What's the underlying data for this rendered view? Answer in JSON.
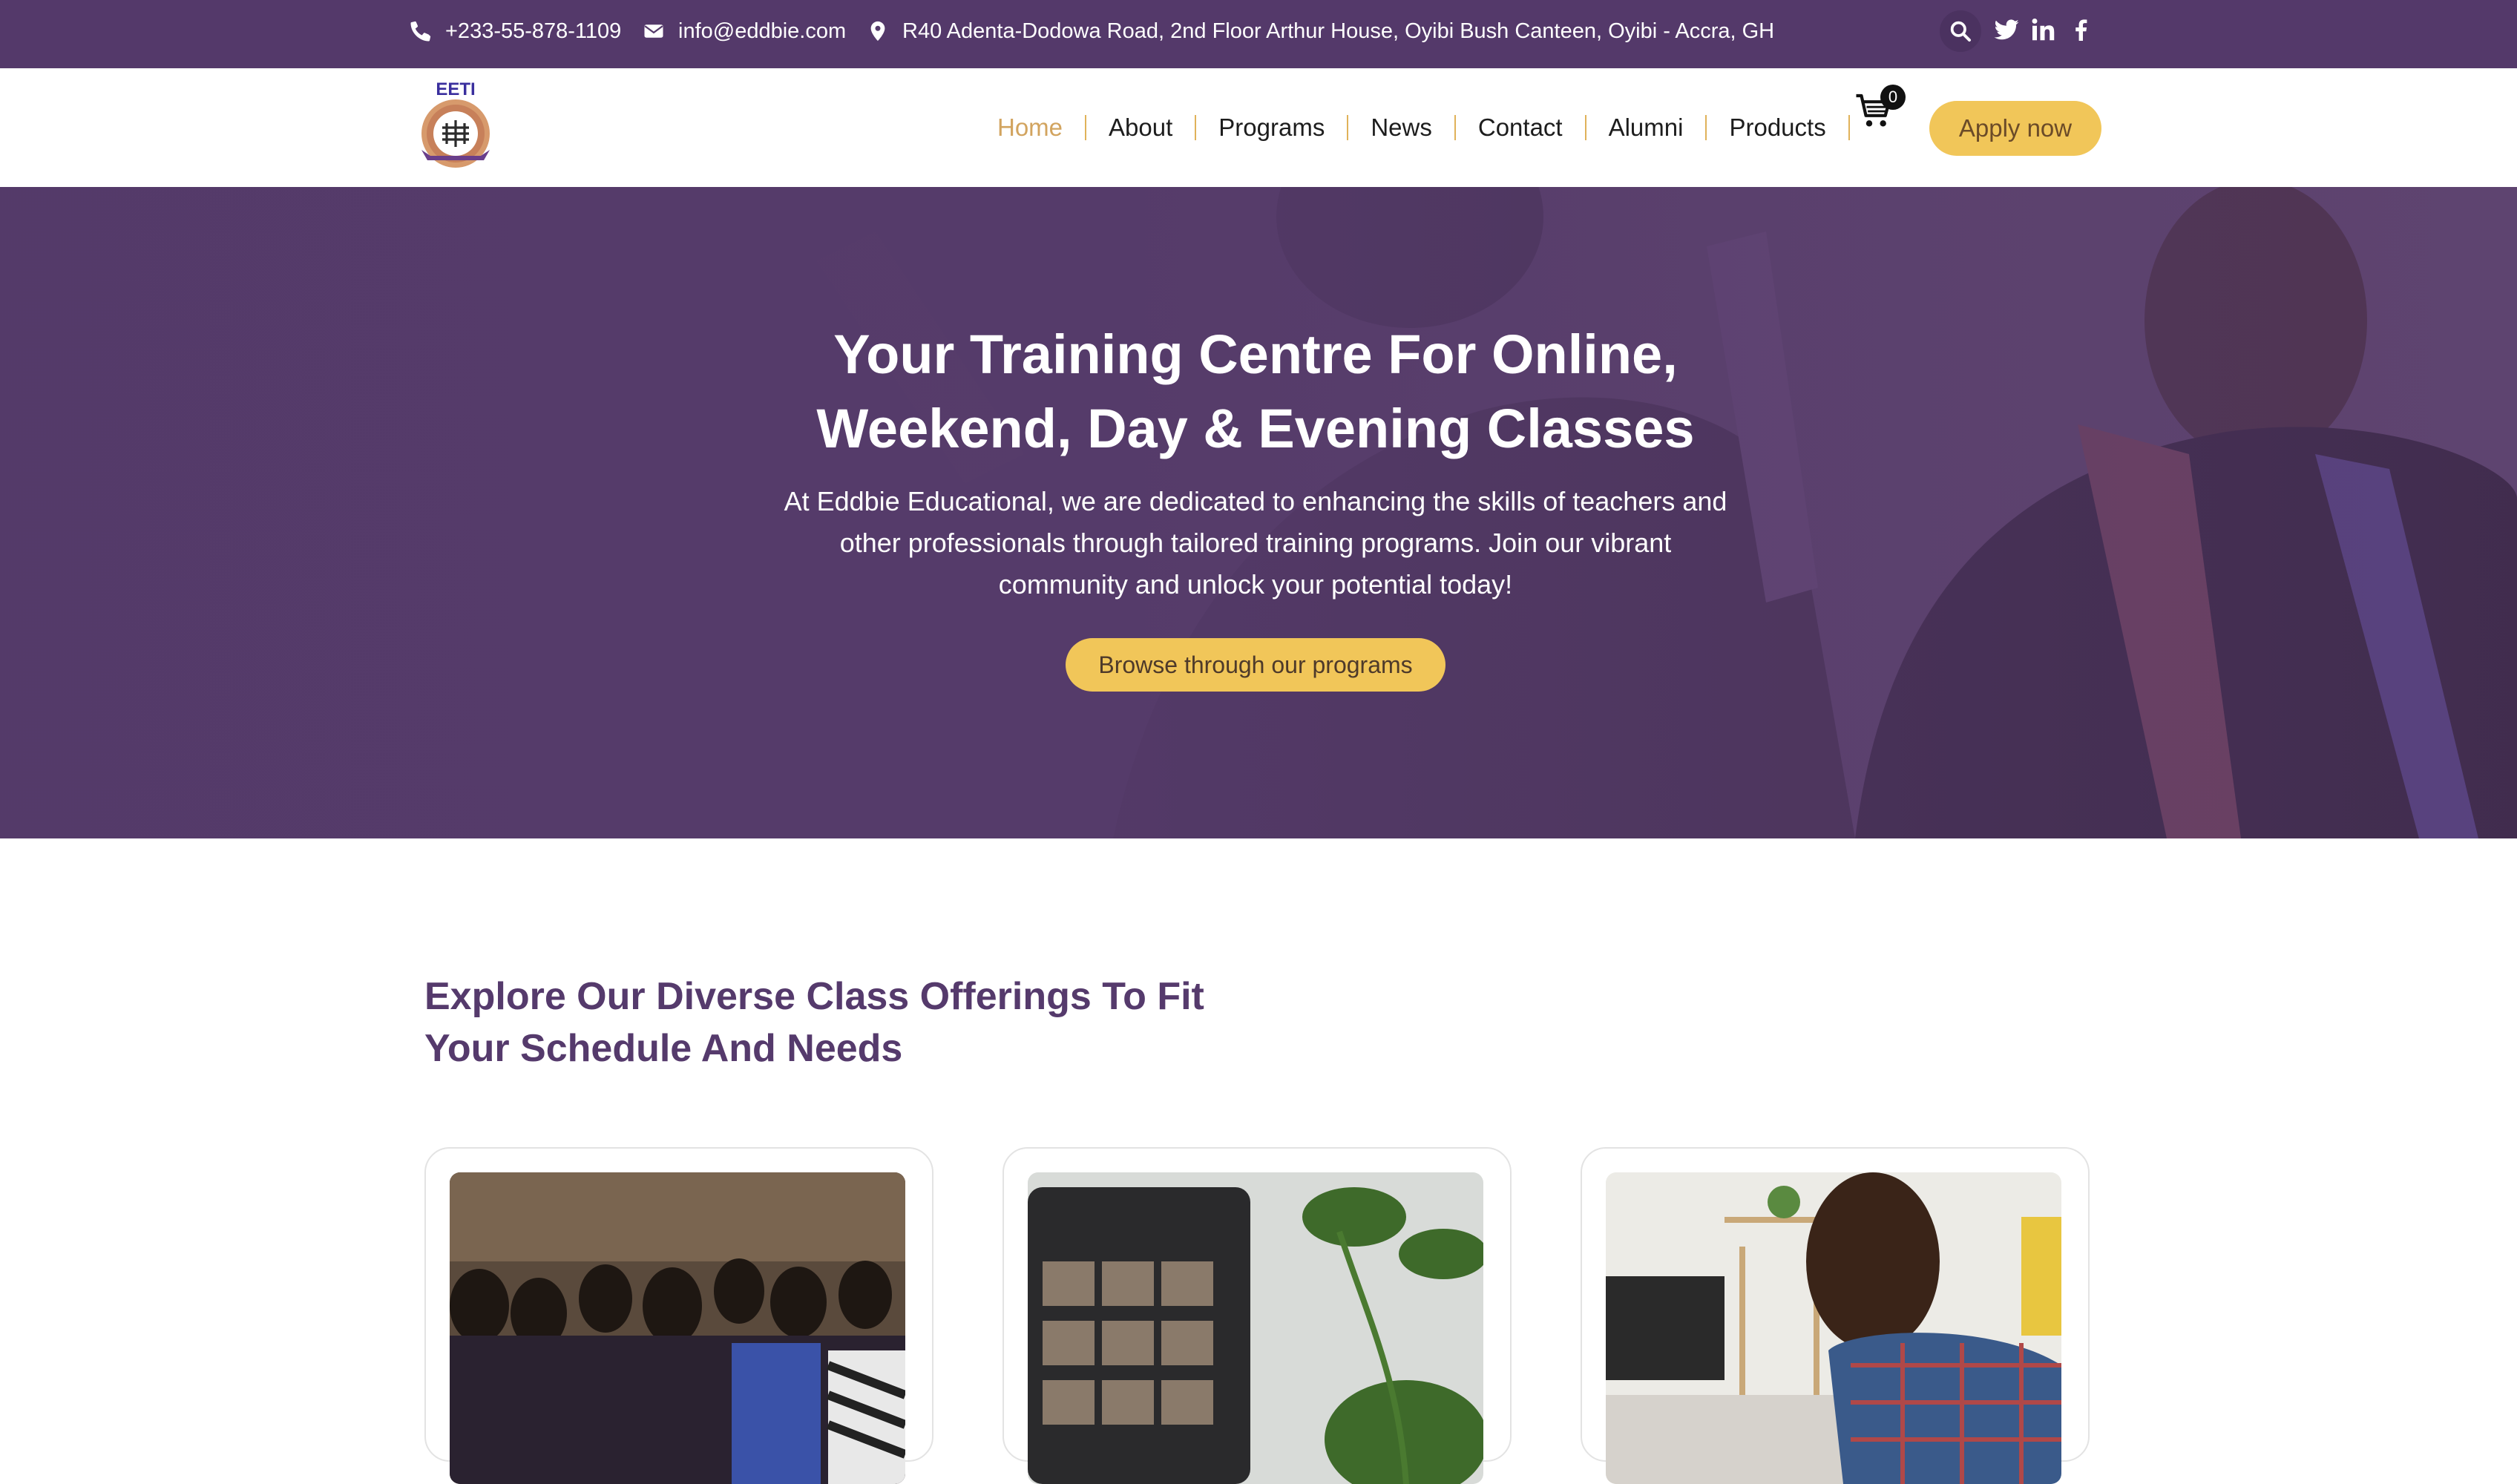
{
  "topbar": {
    "phone": "+233-55-878-1109",
    "email": "info@eddbie.com",
    "address": "R40 Adenta-Dodowa Road, 2nd Floor Arthur House, Oyibi Bush Canteen, Oyibi - Accra, GH",
    "icons": [
      "phone-icon",
      "envelope-icon",
      "map-pin-icon",
      "search-icon",
      "twitter-icon",
      "linkedin-icon",
      "facebook-icon"
    ]
  },
  "header": {
    "logo_text": "EETI",
    "nav": {
      "home": "Home",
      "about": "About",
      "programs": "Programs",
      "news": "News",
      "contact": "Contact",
      "alumni": "Alumni",
      "products": "Products"
    },
    "cart_count": "0",
    "apply_label": "Apply now"
  },
  "hero": {
    "title_line1": "Your Training Centre For Online,",
    "title_line2": "Weekend, Day & Evening Classes",
    "description": "At Eddbie Educational, we are dedicated to enhancing the skills of teachers and other professionals through tailored training programs. Join our vibrant community and unlock your potential today!",
    "button_label": "Browse through our programs"
  },
  "offerings": {
    "title_line1": "Explore Our Diverse Class Offerings To Fit",
    "title_line2": "Your Schedule And Needs",
    "cards": [
      "students-in-lecture-image",
      "online-video-call-image",
      "man-at-laptop-image"
    ]
  },
  "colors": {
    "brand_purple": "#54396a",
    "accent_yellow": "#f1c659",
    "active_nav": "#d2a45f"
  }
}
